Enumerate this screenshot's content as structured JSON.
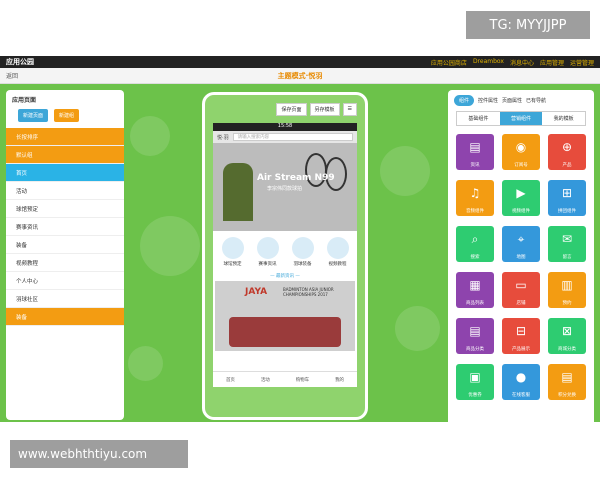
{
  "watermarks": {
    "top_right": "TG: MYYJJPP",
    "bottom_left": "www.webhthtiyu.com"
  },
  "topbar": {
    "logo": "应用公园",
    "links": [
      "应用公园商店",
      "Dreambox",
      "消息中心",
      "应用管理",
      "运营管理"
    ]
  },
  "subbar": {
    "back": "返回",
    "title": "主题模式·悦羽",
    "actions": [
      "模板大厅",
      "客服",
      "帮助",
      "刷新",
      "预览"
    ],
    "save": "发布"
  },
  "left_panel": {
    "title": "应用页面",
    "buttons": [
      "新建页面",
      "新建组"
    ],
    "items": [
      {
        "label": "长按排序",
        "style": "orange"
      },
      {
        "label": "默认组",
        "style": "orange"
      },
      {
        "label": "首页",
        "style": "blue"
      },
      {
        "label": "活动",
        "style": "plain"
      },
      {
        "label": "球馆预定",
        "style": "plain"
      },
      {
        "label": "赛事资讯",
        "style": "plain"
      },
      {
        "label": "装备",
        "style": "plain"
      },
      {
        "label": "视频教程",
        "style": "plain"
      },
      {
        "label": "个人中心",
        "style": "plain"
      },
      {
        "label": "羽球社区",
        "style": "plain"
      },
      {
        "label": "装备",
        "style": "orange"
      }
    ]
  },
  "phone": {
    "tools": [
      "保存页面",
      "另存模板",
      "☰"
    ],
    "time": "15:58",
    "app_tag": "悦·羽",
    "search_placeholder": "请输入搜索内容",
    "banner_title": "Air Stream N99",
    "banner_sub": "李宗伟同款球拍",
    "icons": [
      "球馆预定",
      "赛事资讯",
      "羽球装备",
      "视频教程"
    ],
    "section_title": "— 最新资讯 —",
    "photo_brand": "JAYA",
    "photo_caption": "BADMINTON ASIA JUNIOR CHAMPIONSHIPS 2017",
    "nav": [
      "首页",
      "活动",
      "购物车",
      "我的"
    ]
  },
  "right_panel": {
    "tabs": [
      "组件",
      "控件属性",
      "页面属性",
      "已有导航"
    ],
    "subtabs": [
      "基础组件",
      "营销组件",
      "我的模板"
    ],
    "tiles": [
      {
        "label": "资讯",
        "color": "#8e44ad",
        "glyph": "▤"
      },
      {
        "label": "订阅号",
        "color": "#f39c12",
        "glyph": "◉"
      },
      {
        "label": "产品",
        "color": "#e74c3c",
        "glyph": "⊕"
      },
      {
        "label": "音频组件",
        "color": "#f39c12",
        "glyph": "♫"
      },
      {
        "label": "视频组件",
        "color": "#2ecc71",
        "glyph": "▶"
      },
      {
        "label": "拼团组件",
        "color": "#3498db",
        "glyph": "⊞"
      },
      {
        "label": "搜索",
        "color": "#2ecc71",
        "glyph": "⌕"
      },
      {
        "label": "地图",
        "color": "#3498db",
        "glyph": "⌖"
      },
      {
        "label": "留言",
        "color": "#2ecc71",
        "glyph": "✉"
      },
      {
        "label": "商品列表",
        "color": "#8e44ad",
        "glyph": "▦"
      },
      {
        "label": "店铺",
        "color": "#e74c3c",
        "glyph": "▭"
      },
      {
        "label": "预约",
        "color": "#f39c12",
        "glyph": "▥"
      },
      {
        "label": "商品分类",
        "color": "#8e44ad",
        "glyph": "▤"
      },
      {
        "label": "产品展示",
        "color": "#e74c3c",
        "glyph": "⊟"
      },
      {
        "label": "商城分类",
        "color": "#2ecc71",
        "glyph": "⊠"
      },
      {
        "label": "优惠券",
        "color": "#2ecc71",
        "glyph": "▣"
      },
      {
        "label": "在线客服",
        "color": "#3498db",
        "glyph": "●"
      },
      {
        "label": "积分兑换",
        "color": "#f39c12",
        "glyph": "▤"
      }
    ]
  }
}
